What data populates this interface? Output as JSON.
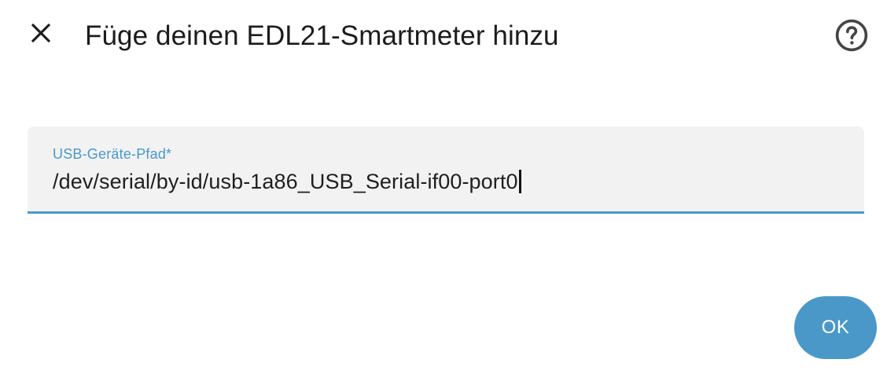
{
  "dialog": {
    "title": "Füge deinen EDL21-Smartmeter hinzu",
    "close_icon": "close-icon",
    "help_icon": "help-circle-icon"
  },
  "form": {
    "usb_path": {
      "label": "USB-Geräte-Pfad*",
      "value": "/dev/serial/by-id/usb-1a86_USB_Serial-if00-port0"
    }
  },
  "actions": {
    "ok_label": "OK"
  },
  "colors": {
    "accent": "#4a98c8",
    "field_background": "#f2f2f2",
    "text": "#1c1c1c",
    "icon": "#444444"
  }
}
